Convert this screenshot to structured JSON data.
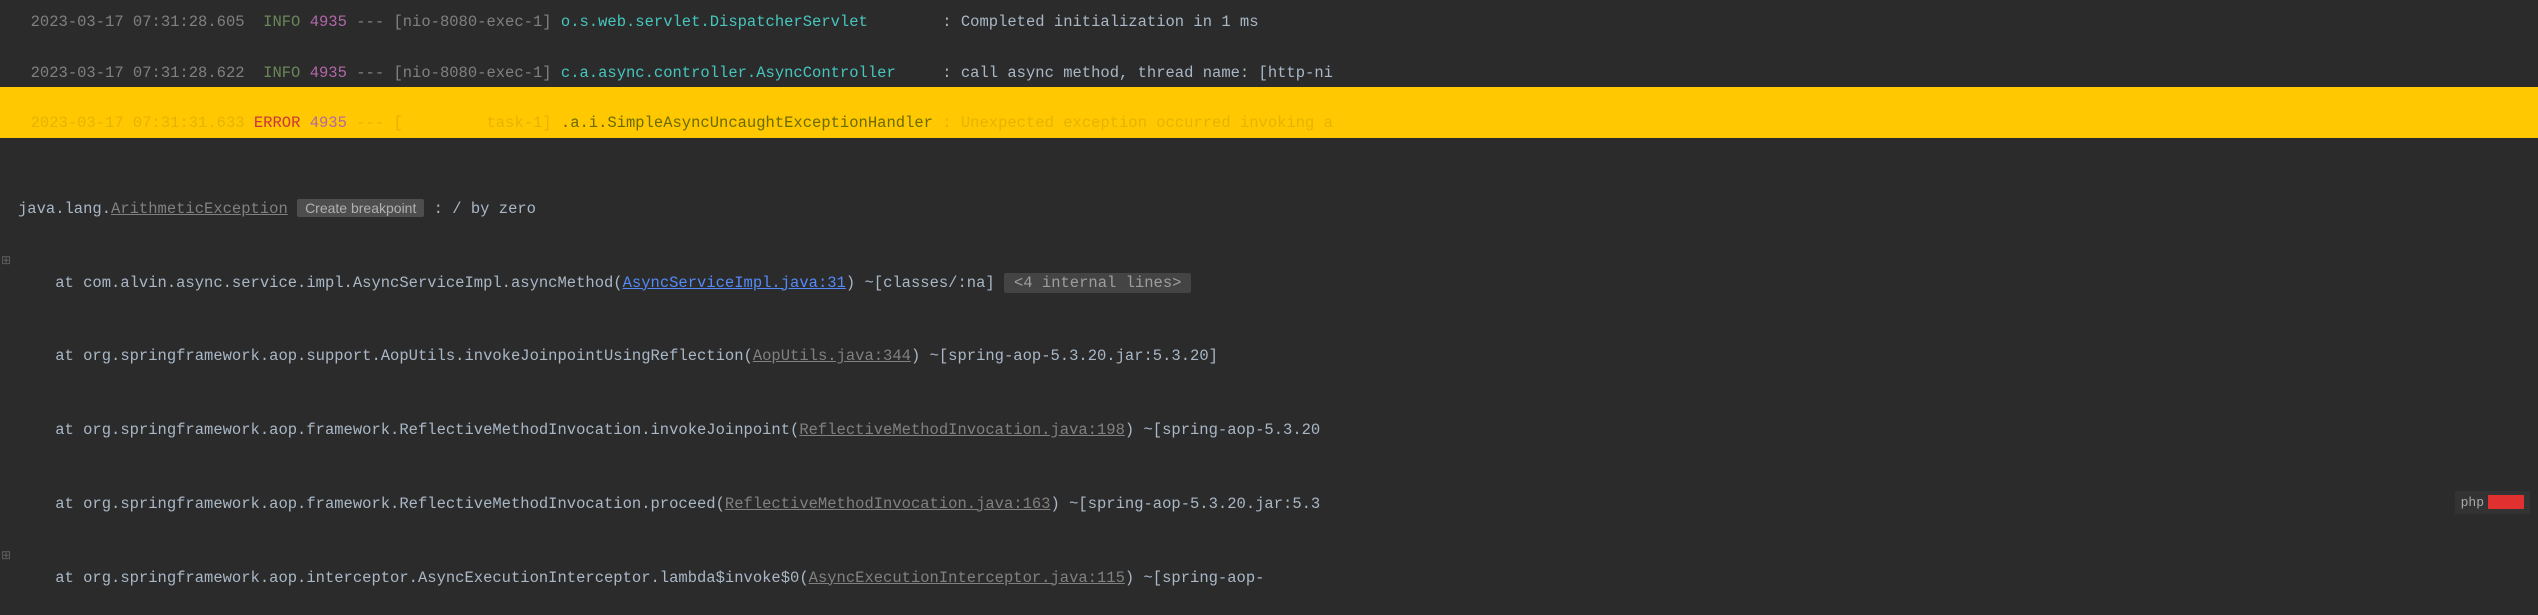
{
  "logs": [
    {
      "ts": "2023-03-17 07:31:28.605",
      "level": "INFO",
      "pid": "4935",
      "thread": "[nio-8080-exec-1]",
      "logger": "o.s.web.servlet.DispatcherServlet",
      "msg": "Completed initialization in 1 ms"
    },
    {
      "ts": "2023-03-17 07:31:28.622",
      "level": "INFO",
      "pid": "4935",
      "thread": "[nio-8080-exec-1]",
      "logger": "c.a.async.controller.AsyncController",
      "msg": "call async method, thread name: [http-ni"
    }
  ],
  "error": {
    "ts": "2023-03-17 07:31:31.633",
    "level": "ERROR",
    "pid": "4935",
    "thread": "[         task-1]",
    "logger": ".a.i.SimpleAsyncUncaughtExceptionHandler",
    "msg": "Unexpected exception occurred invoking a"
  },
  "exception": {
    "prefix": "java.lang.",
    "name": "ArithmeticException",
    "breakpoint_label": "Create breakpoint",
    "message": " : / by zero"
  },
  "stack": [
    {
      "at": "    at com.alvin.async.service.impl.AsyncServiceImpl.asyncMethod(",
      "link": "AsyncServiceImpl.java:31",
      "link_style": "bright",
      "suffix": ") ~[classes/:na]",
      "internal": "<4 internal lines>",
      "expand": true
    },
    {
      "at": "    at org.springframework.aop.support.AopUtils.invokeJoinpointUsingReflection(",
      "link": "AopUtils.java:344",
      "link_style": "dim",
      "suffix": ") ~[spring-aop-5.3.20.jar:5.3.20]"
    },
    {
      "at": "    at org.springframework.aop.framework.ReflectiveMethodInvocation.invokeJoinpoint(",
      "link": "ReflectiveMethodInvocation.java:198",
      "link_style": "dim",
      "suffix": ") ~[spring-aop-5.3.20"
    },
    {
      "at": "    at org.springframework.aop.framework.ReflectiveMethodInvocation.proceed(",
      "link": "ReflectiveMethodInvocation.java:163",
      "link_style": "dim",
      "suffix": ") ~[spring-aop-5.3.20.jar:5.3"
    },
    {
      "at": "    at org.springframework.aop.interceptor.AsyncExecutionInterceptor.lambda$invoke$0(",
      "link": "AsyncExecutionInterceptor.java:115",
      "link_style": "dim",
      "suffix": ") ~[spring-aop-",
      "expand": true
    }
  ],
  "watermark": {
    "text": "php"
  }
}
